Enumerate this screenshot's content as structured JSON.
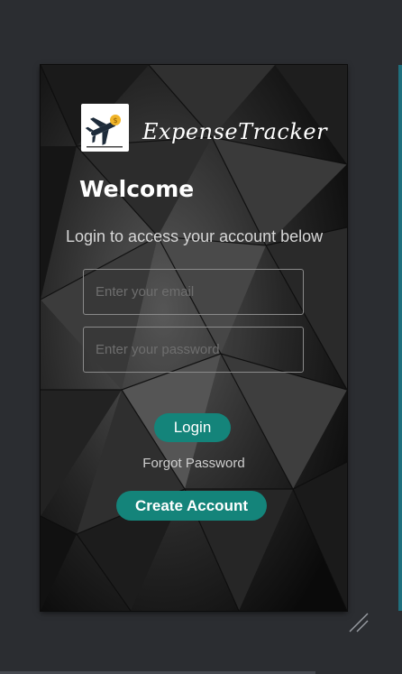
{
  "app": {
    "name": "ExpenseTracker",
    "logo_icon": "airplane-coin-icon"
  },
  "login": {
    "welcome": "Welcome",
    "subtitle": "Login to access your account below",
    "email_placeholder": "Enter your email",
    "password_placeholder": "Enter your password",
    "login_label": "Login",
    "forgot_label": "Forgot Password",
    "create_label": "Create Account"
  },
  "colors": {
    "accent": "#14847a",
    "background": "#2b2d31"
  }
}
